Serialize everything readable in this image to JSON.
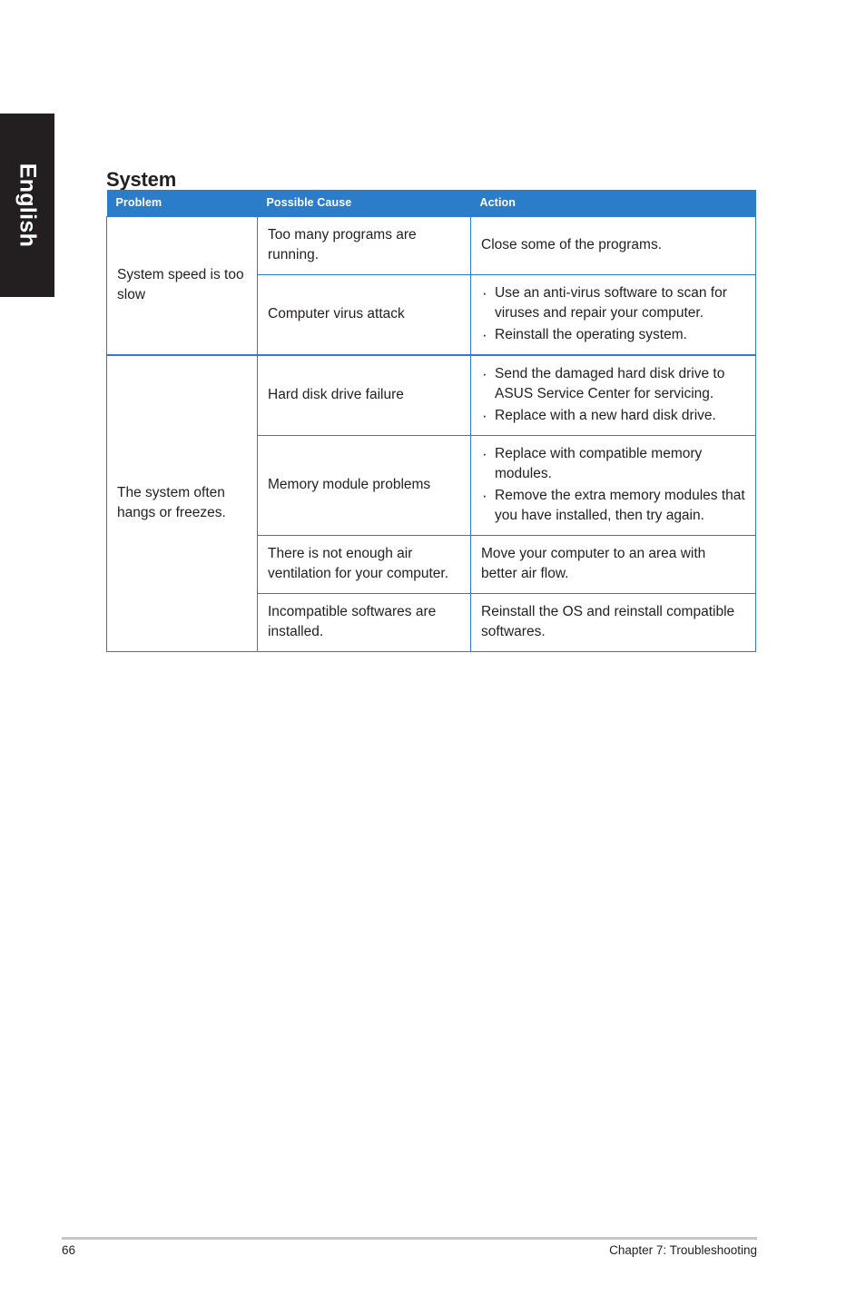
{
  "language_tab": {
    "label": "English"
  },
  "section": {
    "title": "System"
  },
  "table": {
    "headers": {
      "problem": "Problem",
      "possible_cause": "Possible Cause",
      "action": "Action"
    },
    "groups": [
      {
        "problem": "System speed is too slow",
        "rows": [
          {
            "possible_cause": "Too many programs are running.",
            "action_text": "Close some of the programs.",
            "action_bullets": []
          },
          {
            "possible_cause": "Computer virus attack",
            "action_text": "",
            "action_bullets": [
              "Use an anti-virus software to scan for viruses and repair your computer.",
              "Reinstall the operating system."
            ]
          }
        ]
      },
      {
        "problem": "The system often hangs or freezes.",
        "rows": [
          {
            "possible_cause": "Hard disk drive failure",
            "action_text": "",
            "action_bullets": [
              "Send the damaged hard disk drive to ASUS Service Center for servicing.",
              "Replace with a new hard disk drive."
            ]
          },
          {
            "possible_cause": "Memory module problems",
            "action_text": "",
            "action_bullets": [
              "Replace with compatible memory modules.",
              "Remove the extra memory modules that you have installed, then try again."
            ]
          },
          {
            "possible_cause": "There is not enough air ventilation for your computer.",
            "action_text": "Move your computer to an area with better air flow.",
            "action_bullets": []
          },
          {
            "possible_cause": "Incompatible softwares are installed.",
            "action_text": "Reinstall the OS and reinstall compatible softwares.",
            "action_bullets": []
          }
        ]
      }
    ]
  },
  "footer": {
    "page_number": "66",
    "chapter": "Chapter 7: Troubleshooting"
  },
  "colors": {
    "header_blue": "#2b7cc9",
    "tab_black": "#231f20",
    "rule_gray": "#c6c6c6"
  }
}
